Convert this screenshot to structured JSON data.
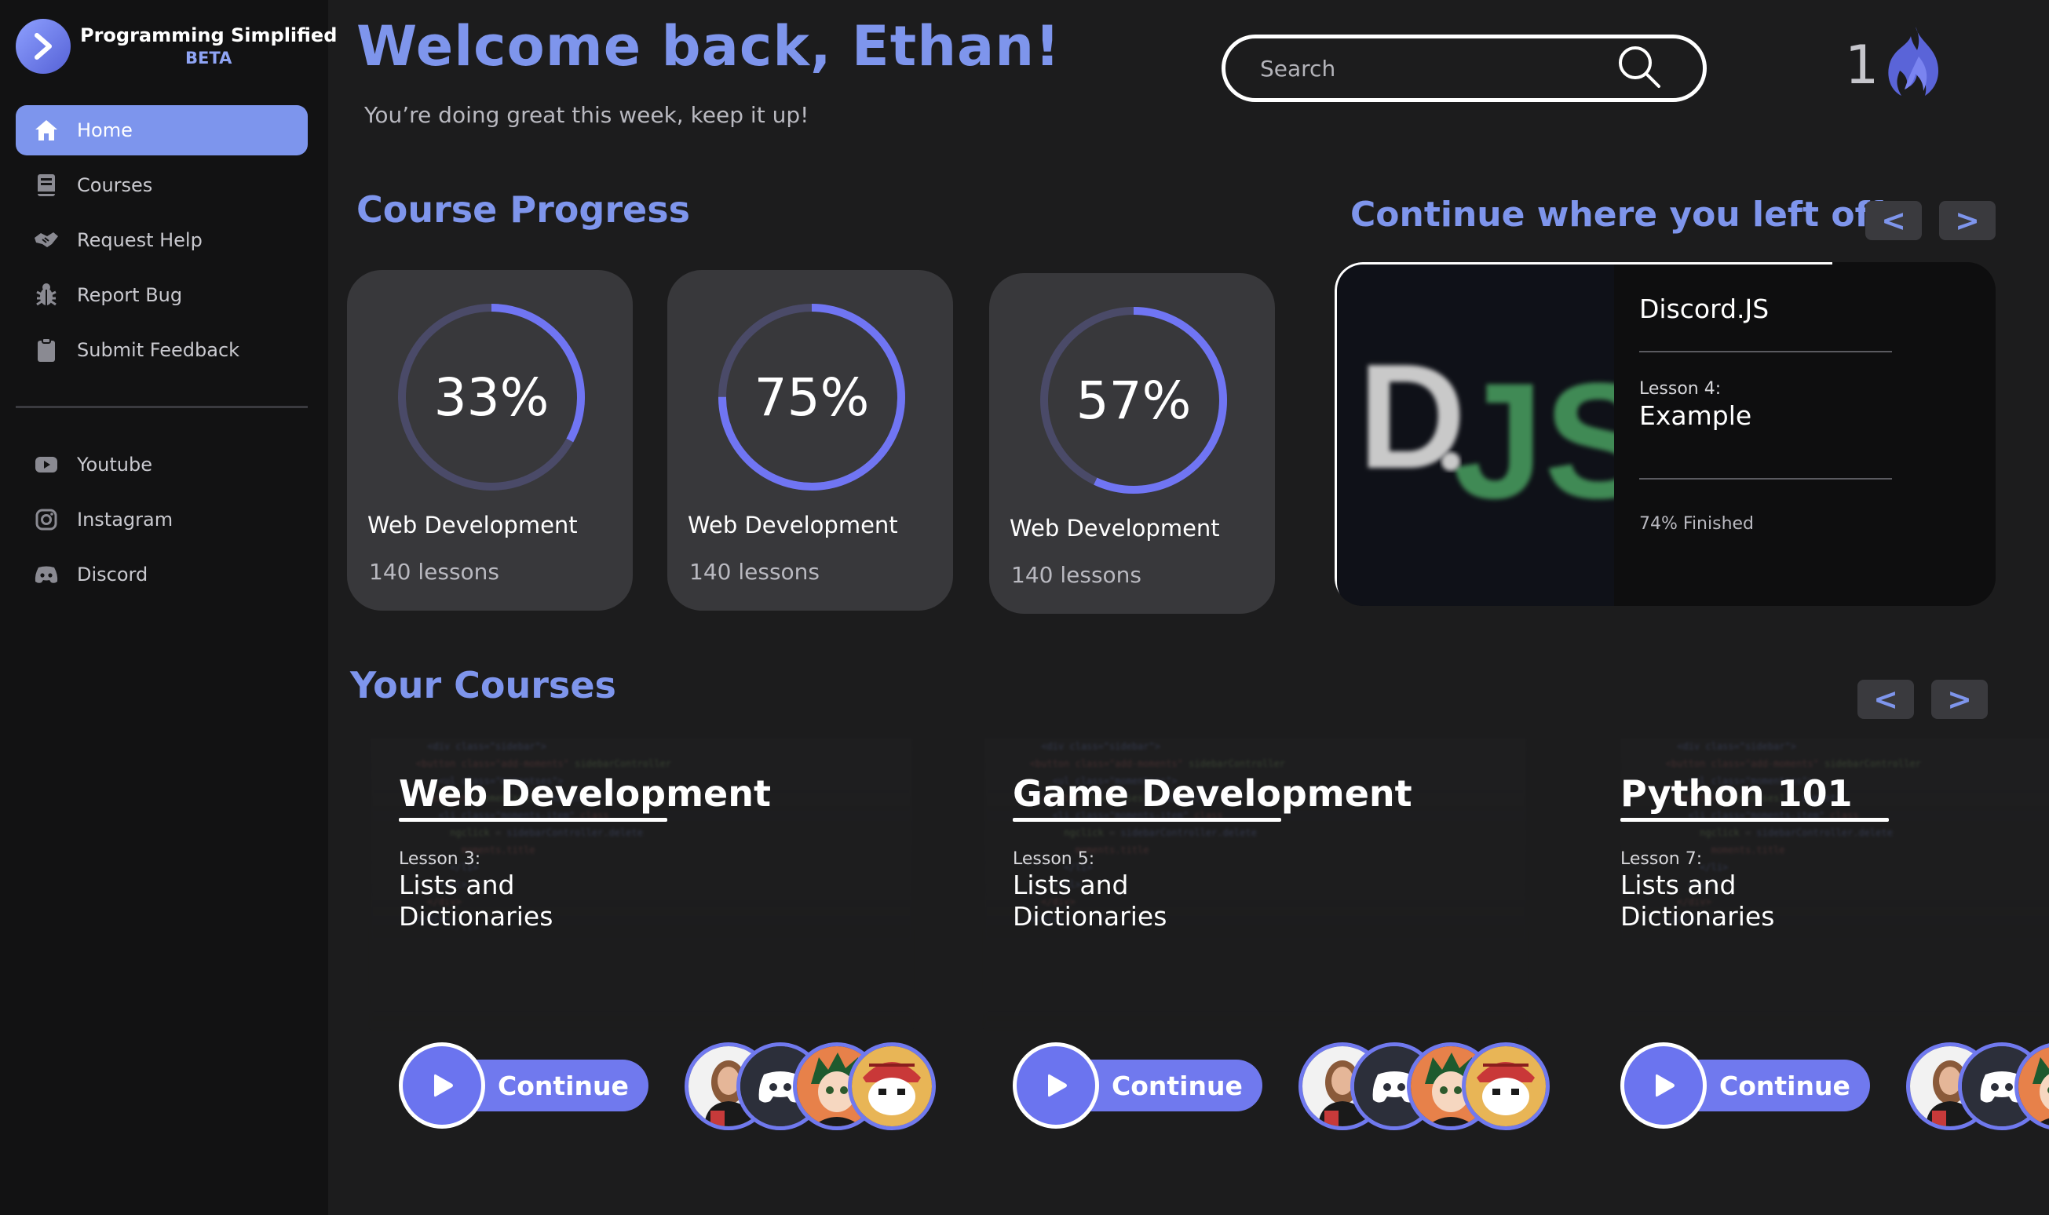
{
  "sidebar": {
    "brand": {
      "name": "Programming Simplified",
      "badge": "BETA"
    },
    "nav": [
      {
        "label": "Home",
        "icon": "home-icon",
        "active": true
      },
      {
        "label": "Courses",
        "icon": "book-icon",
        "active": false
      },
      {
        "label": "Request Help",
        "icon": "handshake-icon",
        "active": false
      },
      {
        "label": "Report Bug",
        "icon": "bug-icon",
        "active": false
      },
      {
        "label": "Submit Feedback",
        "icon": "clipboard-icon",
        "active": false
      }
    ],
    "social": [
      {
        "label": "Youtube",
        "icon": "youtube-icon"
      },
      {
        "label": "Instagram",
        "icon": "instagram-icon"
      },
      {
        "label": "Discord",
        "icon": "discord-icon"
      }
    ]
  },
  "header": {
    "welcome": "Welcome back, Ethan!",
    "subtitle": "You’re doing great this week, keep it up!",
    "search_placeholder": "Search",
    "streak": "1"
  },
  "progress": {
    "title": "Course Progress",
    "cards": [
      {
        "percent_label": "33%",
        "percent": 0.33,
        "course": "Web Development",
        "lessons": "140 lessons"
      },
      {
        "percent_label": "75%",
        "percent": 0.75,
        "course": "Web Development",
        "lessons": "140 lessons"
      },
      {
        "percent_label": "57%",
        "percent": 0.57,
        "course": "Web Development",
        "lessons": "140 lessons"
      }
    ]
  },
  "continue_section": {
    "title": "Continue where you left off...",
    "prev": "<",
    "next": ">",
    "card": {
      "course": "Discord.JS",
      "lesson_no": "Lesson 4:",
      "lesson_title": "Example",
      "finished": "74% Finished",
      "logo_text": {
        "d": "D",
        "js": "JS"
      }
    }
  },
  "courses": {
    "title": "Your Courses",
    "prev": "<",
    "next": ">",
    "button_label": "Continue",
    "items": [
      {
        "title": "Web Development",
        "lesson_no": "Lesson 3:",
        "lesson_title": "Lists and Dictionaries"
      },
      {
        "title": "Game Development",
        "lesson_no": "Lesson 5:",
        "lesson_title": "Lists and Dictionaries"
      },
      {
        "title": "Python 101",
        "lesson_no": "Lesson 7:",
        "lesson_title": "Lists and Dictionaries"
      }
    ]
  },
  "colors": {
    "accent": "#7e95ec",
    "button": "#7079ee",
    "background": "#1c1c1d",
    "sidebar": "#121213",
    "card": "#38383b",
    "ring_track": "#4a4a68",
    "ring_fill": "#7075f3"
  }
}
